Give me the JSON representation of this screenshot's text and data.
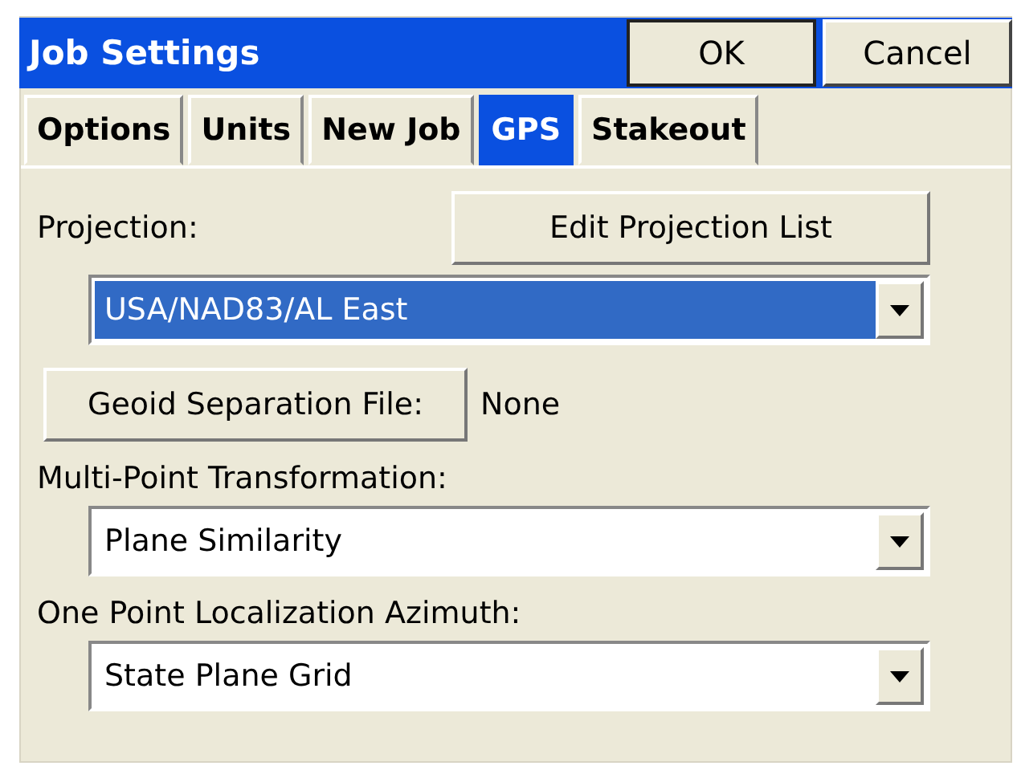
{
  "window": {
    "title": "Job Settings"
  },
  "title_buttons": [
    "OK",
    "Cancel"
  ],
  "tabs": [
    {
      "label": "Options",
      "selected": false
    },
    {
      "label": "Units",
      "selected": false
    },
    {
      "label": "New Job",
      "selected": false
    },
    {
      "label": "GPS",
      "selected": true
    },
    {
      "label": "Stakeout",
      "selected": false
    }
  ],
  "projection": {
    "label": "Projection:",
    "button": "Edit Projection List",
    "value": "USA/NAD83/AL East",
    "focused": true
  },
  "geoid": {
    "button": "Geoid Separation File:",
    "value": "None"
  },
  "multi_point": {
    "label": "Multi-Point Transformation:",
    "value": "Plane Similarity",
    "focused": false
  },
  "one_point": {
    "label": "One Point Localization Azimuth:",
    "value": "State Plane Grid",
    "focused": false
  }
}
